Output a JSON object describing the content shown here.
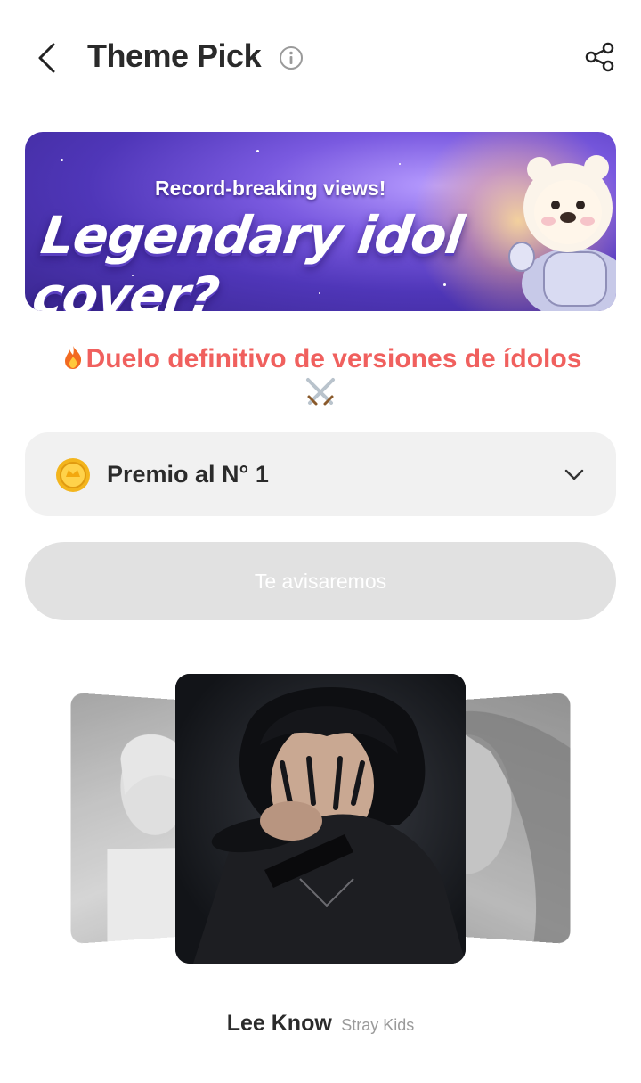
{
  "header": {
    "title": "Theme Pick",
    "back_icon": "chevron-left-icon",
    "info_icon": "info-icon",
    "share_icon": "share-icon"
  },
  "banner": {
    "subtitle": "Record-breaking views!",
    "headline": "Legendary idol cover?"
  },
  "duel": {
    "title": "Duelo definitivo de versiones de ídolos",
    "prefix_emoji": "fire-icon",
    "suffix_emoji": "crossed-swords-icon"
  },
  "prize": {
    "label": "Premio al N° 1",
    "icon": "coin-icon",
    "chevron": "chevron-down-icon"
  },
  "notify": {
    "label": "Te avisaremos"
  },
  "candidate": {
    "name": "Lee Know",
    "group": "Stray Kids"
  },
  "colors": {
    "accent": "#f0605e",
    "banner_purple": "#5a40c0",
    "disabled_button": "#e1e1e1",
    "prize_bg": "#f1f1f1"
  }
}
